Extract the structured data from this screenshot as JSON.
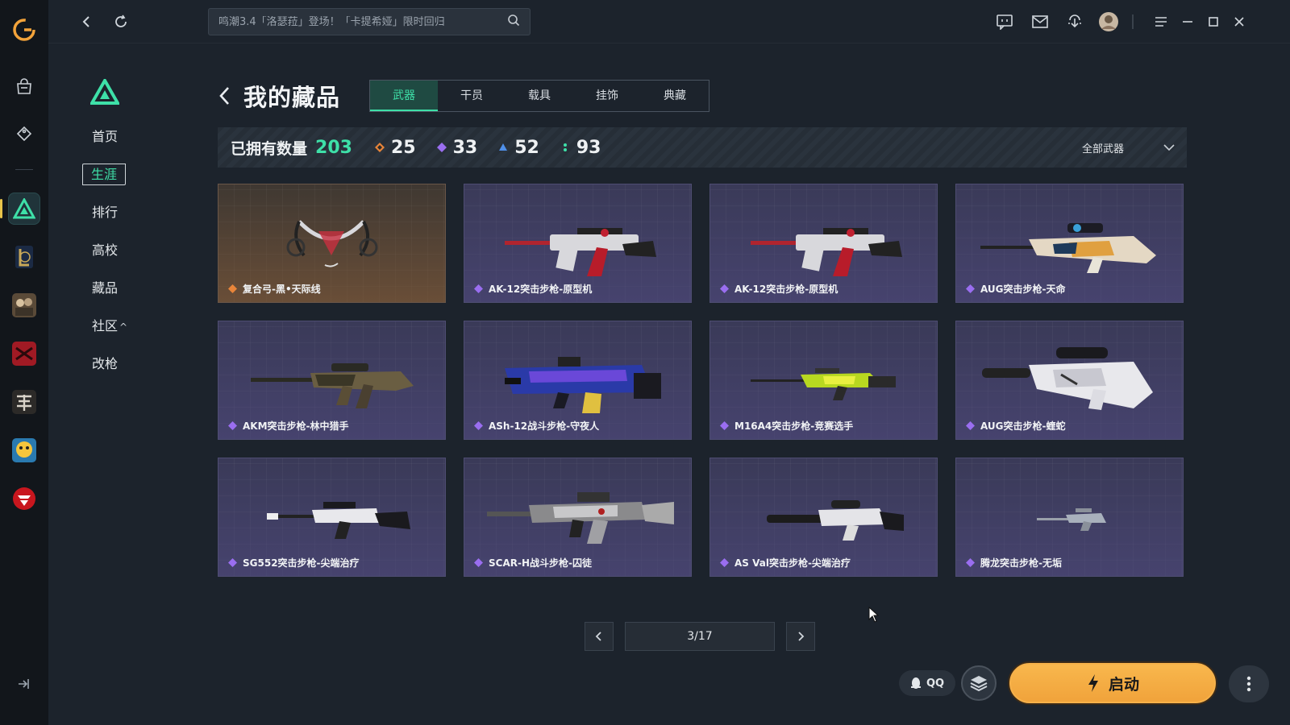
{
  "topbar": {
    "search_placeholder": "鸣潮3.4「洛瑟菈」登场！「卡提希娅」限时回归"
  },
  "subnav": {
    "items": [
      {
        "label": "首页",
        "active": false
      },
      {
        "label": "生涯",
        "active": true
      },
      {
        "label": "排行",
        "active": false
      },
      {
        "label": "高校",
        "active": false
      },
      {
        "label": "藏品",
        "active": false
      },
      {
        "label": "社区",
        "active": false,
        "expand": "^"
      },
      {
        "label": "改枪",
        "active": false
      }
    ]
  },
  "main": {
    "title": "我的藏品",
    "tabs": [
      {
        "label": "武器",
        "active": true
      },
      {
        "label": "干员",
        "active": false
      },
      {
        "label": "载具",
        "active": false
      },
      {
        "label": "挂饰",
        "active": false
      },
      {
        "label": "典藏",
        "active": false
      }
    ],
    "stats": {
      "owned_label": "已拥有数量",
      "owned_value": "203",
      "rarities": [
        {
          "color": "#e8853a",
          "value": "25"
        },
        {
          "color": "#9a6ef0",
          "value": "33"
        },
        {
          "color": "#4f8fe8",
          "value": "52"
        },
        {
          "color": "#3ee0a8",
          "value": "93"
        }
      ]
    },
    "filter_label": "全部武器",
    "items": [
      {
        "name": "复合弓-黑•天际线",
        "rarity": "orange",
        "art": "bow"
      },
      {
        "name": "AK-12突击步枪-原型机",
        "rarity": "purple",
        "art": "ak12"
      },
      {
        "name": "AK-12突击步枪-原型机",
        "rarity": "purple",
        "art": "ak12"
      },
      {
        "name": "AUG突击步枪-天命",
        "rarity": "purple",
        "art": "aug"
      },
      {
        "name": "AKM突击步枪-林中猎手",
        "rarity": "purple",
        "art": "akm"
      },
      {
        "name": "ASh-12战斗步枪-守夜人",
        "rarity": "purple",
        "art": "ash"
      },
      {
        "name": "M16A4突击步枪-竞赛选手",
        "rarity": "purple",
        "art": "m16"
      },
      {
        "name": "AUG突击步枪-蝰蛇",
        "rarity": "purple",
        "art": "aug2"
      },
      {
        "name": "SG552突击步枪-尖端治疗",
        "rarity": "purple",
        "art": "sg552"
      },
      {
        "name": "SCAR-H战斗步枪-囚徒",
        "rarity": "purple",
        "art": "scar"
      },
      {
        "name": "AS Val突击步枪-尖端治疗",
        "rarity": "purple",
        "art": "asval"
      },
      {
        "name": "腾龙突击步枪-无垢",
        "rarity": "purple",
        "art": "tenglong"
      }
    ],
    "pagination": {
      "current_label": "3/17"
    }
  },
  "actions": {
    "qq_label": "QQ",
    "launch_label": "启动"
  },
  "colors": {
    "accent": "#3ee0a8",
    "launch": "#f5ac44"
  }
}
